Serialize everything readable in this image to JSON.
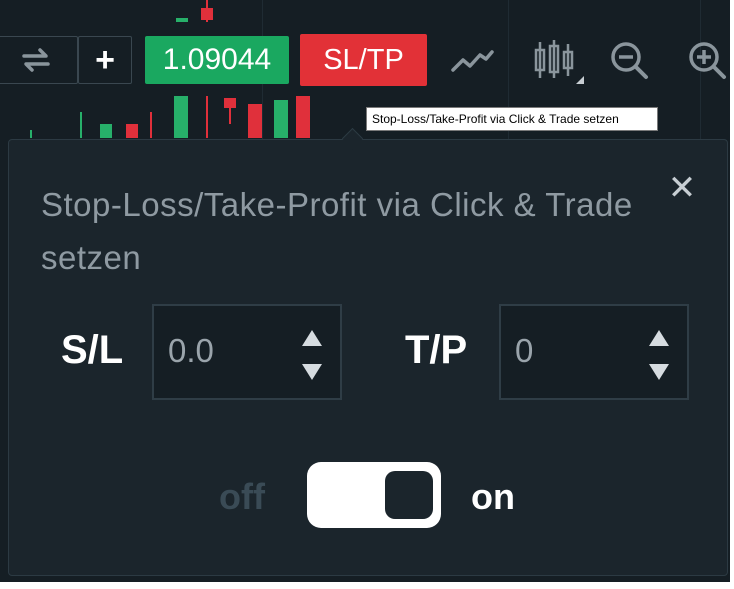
{
  "toolbar": {
    "plus_label": "+",
    "price": "1.09044",
    "sltp_label": "SL/TP",
    "icons": [
      "sync-icon",
      "line-chart-icon",
      "candlestick-icon",
      "zoom-out-icon",
      "zoom-in-icon"
    ]
  },
  "tooltip": {
    "text": "Stop-Loss/Take-Profit via Click & Trade setzen"
  },
  "panel": {
    "title": "Stop-Loss/Take-Profit via Click & Trade setzen",
    "close_label": "✕",
    "sl": {
      "label": "S/L",
      "value": "0.0"
    },
    "tp": {
      "label": "T/P",
      "value": "0"
    },
    "toggle": {
      "off_label": "off",
      "on_label": "on",
      "state": "on"
    }
  },
  "colors": {
    "background": "#151e24",
    "panel": "#1b252c",
    "price_green": "#1aa860",
    "sltp_red": "#e23137",
    "text_muted": "#8f9aa2"
  }
}
